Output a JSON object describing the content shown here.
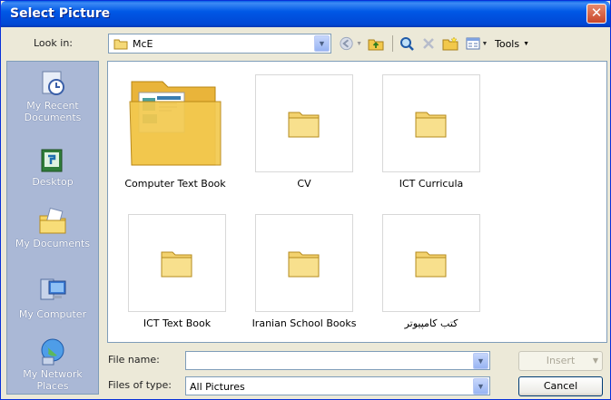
{
  "window": {
    "title": "Select Picture",
    "close_glyph": "✕"
  },
  "toolbar": {
    "look_in_label": "Look in:",
    "look_in_value": "McE",
    "tools_label": "Tools",
    "icons": [
      "back-icon",
      "up-folder-icon",
      "search-web-icon",
      "delete-icon",
      "new-folder-icon",
      "views-icon"
    ]
  },
  "places": [
    {
      "label": "My Recent Documents",
      "icon": "recent-documents-icon"
    },
    {
      "label": "Desktop",
      "icon": "desktop-icon"
    },
    {
      "label": "My Documents",
      "icon": "my-documents-icon"
    },
    {
      "label": "My Computer",
      "icon": "my-computer-icon"
    },
    {
      "label": "My Network Places",
      "icon": "network-places-icon"
    }
  ],
  "files": [
    {
      "name": "Computer Text Book",
      "selected": true
    },
    {
      "name": "CV"
    },
    {
      "name": "ICT Curricula"
    },
    {
      "name": "ICT Text Book"
    },
    {
      "name": "Iranian School Books"
    },
    {
      "name": "کتب کامپیوتر"
    }
  ],
  "bottom": {
    "file_name_label": "File name:",
    "file_name_value": "",
    "files_of_type_label": "Files of type:",
    "files_of_type_value": "All Pictures",
    "insert_label": "Insert",
    "cancel_label": "Cancel"
  },
  "colors": {
    "titlebar": "#0058e6",
    "places_bg": "#aab8d6",
    "dialog_bg": "#ece9d8"
  }
}
